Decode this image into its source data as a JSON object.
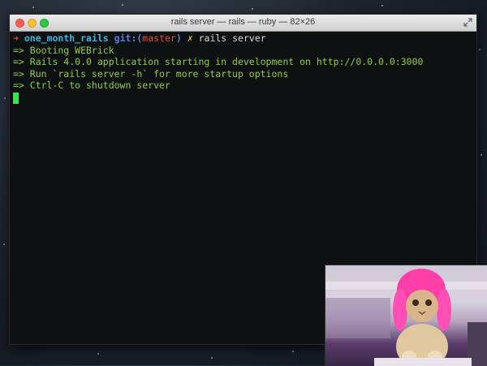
{
  "window": {
    "title": "rails server — rails — ruby — 82×26"
  },
  "terminal": {
    "prompt": {
      "arrow": "➜",
      "directory": "one_month_rails",
      "git_label": "git:(",
      "branch": "master",
      "git_close": ")",
      "dirty_mark": "✗",
      "command": "rails server"
    },
    "output_lines": [
      "=> Booting WEBrick",
      "=> Rails 4.0.0 application starting in development on http://0.0.0.0:3000",
      "=> Run `rails server -h` for more startup options",
      "=> Ctrl-C to shutdown server"
    ]
  },
  "colors": {
    "output_text": "#93cd44",
    "prompt_arrow": "#e84a3f",
    "directory": "#3fb6e0",
    "git": "#5a7de0",
    "cursor": "#3fe04b",
    "terminal_bg": "#0e1111"
  }
}
